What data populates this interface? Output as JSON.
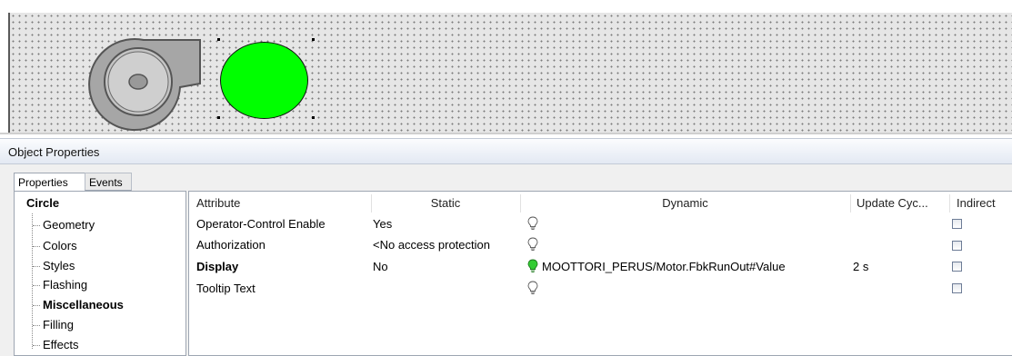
{
  "window": {
    "title": "Object Properties"
  },
  "tabs": [
    {
      "label": "Properties",
      "active": true
    },
    {
      "label": "Events",
      "active": false
    }
  ],
  "tree": {
    "root": "Circle",
    "items": [
      {
        "label": "Geometry",
        "selected": false
      },
      {
        "label": "Colors",
        "selected": false
      },
      {
        "label": "Styles",
        "selected": false
      },
      {
        "label": "Flashing",
        "selected": false
      },
      {
        "label": "Miscellaneous",
        "selected": true
      },
      {
        "label": "Filling",
        "selected": false
      },
      {
        "label": "Effects",
        "selected": false
      }
    ]
  },
  "grid": {
    "columns": [
      "Attribute",
      "Static",
      "Dynamic",
      "Update Cyc...",
      "Indirect"
    ],
    "rows": [
      {
        "attribute": "Operator-Control Enable",
        "static": "Yes",
        "dynamic": "",
        "update": "",
        "bulb": "off",
        "bold": false,
        "indirect": false
      },
      {
        "attribute": "Authorization",
        "static": "<No access protection",
        "dynamic": "",
        "update": "",
        "bulb": "off",
        "bold": false,
        "indirect": false
      },
      {
        "attribute": "Display",
        "static": "No",
        "dynamic": "MOOTTORI_PERUS/Motor.FbkRunOut#Value",
        "update": "2 s",
        "bulb": "on",
        "bold": true,
        "indirect": false
      },
      {
        "attribute": "Tooltip Text",
        "static": "",
        "dynamic": "",
        "update": "",
        "bulb": "off",
        "bold": false,
        "indirect": false
      }
    ]
  },
  "colors": {
    "circle_fill": "#00ff00",
    "blower_fill": "#a6a6a6",
    "bulb_on": "#33cc33",
    "bulb_off": "#ffffff"
  }
}
